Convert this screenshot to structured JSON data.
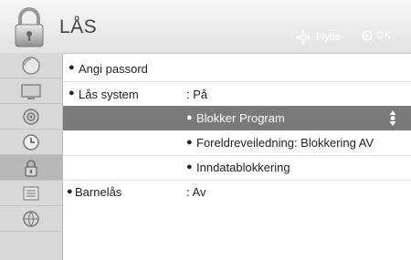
{
  "header": {
    "title": "LÅS",
    "hint_move": "Flytte",
    "hint_ok": "OK"
  },
  "sidebar": {
    "items": [
      {
        "icon": "picture-icon"
      },
      {
        "icon": "screen-icon"
      },
      {
        "icon": "speaker-icon"
      },
      {
        "icon": "clock-icon"
      },
      {
        "icon": "lock-icon",
        "active": true
      },
      {
        "icon": "options-icon"
      },
      {
        "icon": "network-icon"
      }
    ]
  },
  "menu": {
    "set_password": "Angi passord",
    "lock_system": "Lås system",
    "lock_system_value": ": På",
    "block_program": "Blokker Program",
    "parental_guidance": "Foreldreveiledning: Blokkering AV",
    "input_block": "Inndatablokkering",
    "child_lock": "Barnelås",
    "child_lock_value": ": Av"
  },
  "colors": {
    "selected_row": "#7a7a7a",
    "sidebar_bg": "#d8d8d8",
    "header_text": "#444444"
  }
}
